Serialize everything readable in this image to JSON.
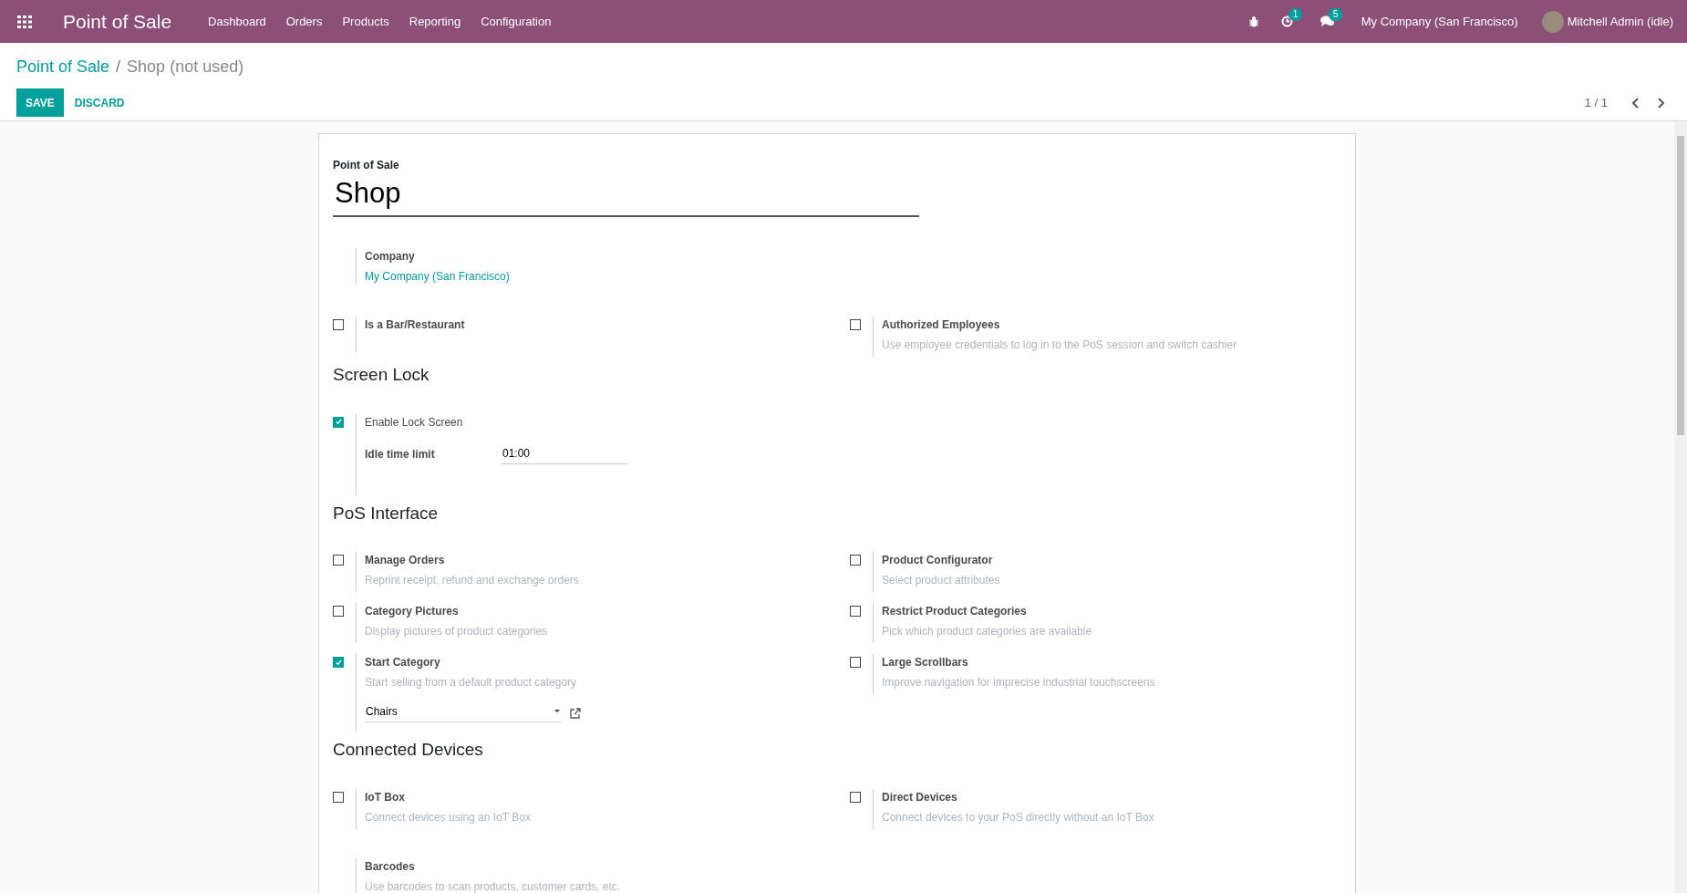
{
  "navbar": {
    "app_title": "Point of Sale",
    "menus": [
      "Dashboard",
      "Orders",
      "Products",
      "Reporting",
      "Configuration"
    ],
    "activity_count": "1",
    "message_count": "5",
    "company": "My Company (San Francisco)",
    "user": "Mitchell Admin (idle)"
  },
  "breadcrumb_separator": "/",
  "breadcrumb": [
    {
      "label": "Point of Sale",
      "kind": "link"
    },
    {
      "label": "Shop (not used)",
      "kind": "current"
    }
  ],
  "buttons": {
    "save": "SAVE",
    "discard": "DISCARD"
  },
  "pager": "1 / 1",
  "form": {
    "name_label": "Point of Sale",
    "name": "Shop",
    "company": {
      "label": "Company",
      "value": "My Company (San Francisco)"
    },
    "sections": [
      {
        "settings": [
          {
            "kind": "checkbox",
            "label": "Is a Bar/Restaurant",
            "bold": true,
            "checked": false
          },
          {
            "kind": "checkbox",
            "label": "Authorized Employees",
            "bold": true,
            "checked": false,
            "description": "Use employee credentials to log in to the PoS session and switch cashier"
          }
        ]
      },
      {
        "title": "Screen Lock",
        "settings": [
          {
            "kind": "checkbox",
            "label": "Enable Lock Screen",
            "bold": false,
            "checked": true,
            "field": {
              "label": "Idle time limit",
              "value": "01:00"
            }
          }
        ]
      },
      {
        "title": "PoS Interface",
        "settings": [
          {
            "kind": "checkbox",
            "label": "Manage Orders",
            "bold": true,
            "checked": false,
            "description": "Reprint receipt, refund and exchange orders"
          },
          {
            "kind": "checkbox",
            "label": "Product Configurator",
            "bold": true,
            "checked": false,
            "description": "Select product attributes"
          },
          {
            "kind": "checkbox",
            "label": "Category Pictures",
            "bold": true,
            "checked": false,
            "description": "Display pictures of product categories"
          },
          {
            "kind": "checkbox",
            "label": "Restrict Product Categories",
            "bold": true,
            "checked": false,
            "description": "Pick which product categories are available"
          },
          {
            "kind": "checkbox",
            "label": "Start Category",
            "bold": true,
            "checked": true,
            "description": "Start selling from a default product category",
            "select": {
              "value": "Chairs"
            }
          },
          {
            "kind": "checkbox",
            "label": "Large Scrollbars",
            "bold": true,
            "checked": false,
            "description": "Improve navigation for imprecise industrial touchscreens"
          }
        ]
      },
      {
        "title": "Connected Devices",
        "settings": [
          {
            "kind": "checkbox",
            "label": "IoT Box",
            "bold": true,
            "checked": false,
            "description": "Connect devices using an IoT Box"
          },
          {
            "kind": "checkbox",
            "label": "Direct Devices",
            "bold": true,
            "checked": false,
            "description": "Connect devices to your PoS directly without an IoT Box"
          },
          {
            "kind": "info",
            "label": "Barcodes",
            "bold": true,
            "description": "Use barcodes to scan products, customer cards, etc."
          }
        ]
      }
    ]
  }
}
